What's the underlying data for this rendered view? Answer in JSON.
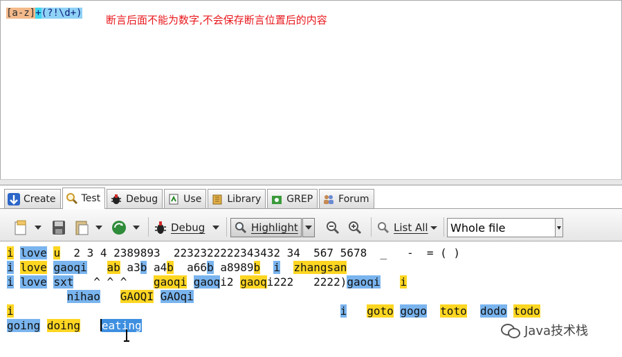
{
  "regex": {
    "charclass": "[a-z]",
    "quantifier": "+",
    "lookahead": "(?!\\d+)",
    "note": "断言后面不能为数字,不会保存断言位置后的内容"
  },
  "tabs": [
    {
      "label": "Create",
      "icon": "create-icon"
    },
    {
      "label": "Test",
      "icon": "magnifier-icon"
    },
    {
      "label": "Debug",
      "icon": "bug-icon"
    },
    {
      "label": "Use",
      "icon": "use-icon"
    },
    {
      "label": "Library",
      "icon": "library-icon"
    },
    {
      "label": "GREP",
      "icon": "grep-icon"
    },
    {
      "label": "Forum",
      "icon": "forum-icon"
    }
  ],
  "active_tab": "Test",
  "toolbar": {
    "debug_label": "Debug",
    "highlight_label": "Highlight",
    "listall_label": "List All",
    "scope_value": "Whole file"
  },
  "test_text": {
    "l1": {
      "a": "i",
      "b": "love",
      "c": "u",
      "d": "  2 3 4 2389893  2232322222343432 34  567 5678  _   -  = ( )"
    },
    "l2": {
      "a": "i",
      "b": "love",
      "c": "gaoqi",
      "s1": "   ",
      "d": "ab",
      "s2": " a3",
      "e": "b",
      "s3": " a4",
      "f": "b",
      "s4": "  a66",
      "g": "b",
      "s5": " a8989",
      "h": "b",
      "s6": "  ",
      "i": "i",
      "s7": "  ",
      "j": "zhangsan"
    },
    "l3": {
      "a": "i",
      "b": "love",
      "c": "sxt",
      "s1": "   ^ ^ ^    ",
      "d": "gaoqi",
      "s2": " ",
      "e": "gaoq",
      "s3": "i2 ",
      "f": "gaoq",
      "s4": "i222   2222)",
      "g": "gaoqi",
      "s5": "   ",
      "h": "i"
    },
    "l4": {
      "s0": "         ",
      "a": "nihao",
      "s1": "   ",
      "b": "GAOQI",
      "s2": " ",
      "c": "GAOqi"
    },
    "l5": {
      "a": "i",
      "s1": "                                                 ",
      "b": "i",
      "s2": "   ",
      "c": "goto",
      "s3": " ",
      "d": "gogo",
      "s4": "  ",
      "e": "toto",
      "s5": "  ",
      "f": "dodo",
      "s6": " ",
      "g": "todo"
    },
    "l6": {
      "a": "going",
      "s1": " ",
      "b": "doing",
      "s2": "   ",
      "c": "eating"
    }
  },
  "watermark": "Java技术栈"
}
